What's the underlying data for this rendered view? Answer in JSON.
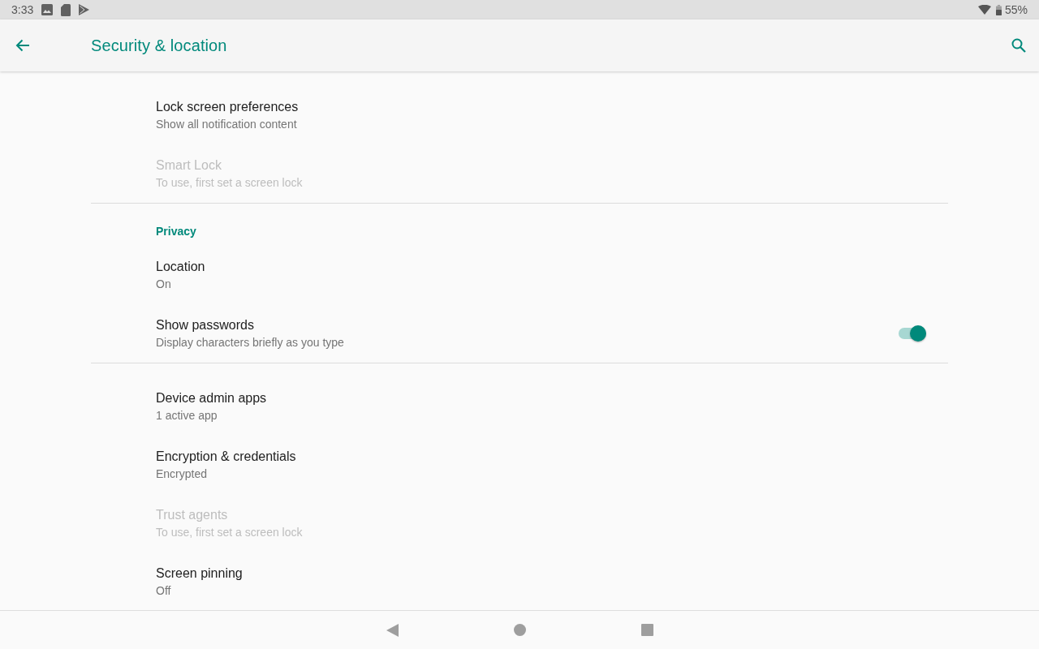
{
  "status_bar": {
    "time": "3:33",
    "battery": "55%"
  },
  "app_bar": {
    "title": "Security & location"
  },
  "sections": [
    {
      "items": [
        {
          "kind": "text",
          "title": "Lock screen preferences",
          "summary": "Show all notification content",
          "disabled": false
        },
        {
          "kind": "text",
          "title": "Smart Lock",
          "summary": "To use, first set a screen lock",
          "disabled": true
        }
      ]
    },
    {
      "header": "Privacy",
      "items": [
        {
          "kind": "text",
          "title": "Location",
          "summary": "On",
          "disabled": false
        },
        {
          "kind": "switch",
          "title": "Show passwords",
          "summary": "Display characters briefly as you type",
          "disabled": false,
          "on": true
        }
      ]
    },
    {
      "items": [
        {
          "kind": "text",
          "title": "Device admin apps",
          "summary": "1 active app",
          "disabled": false
        },
        {
          "kind": "text",
          "title": "Encryption & credentials",
          "summary": "Encrypted",
          "disabled": false
        },
        {
          "kind": "text",
          "title": "Trust agents",
          "summary": "To use, first set a screen lock",
          "disabled": true
        },
        {
          "kind": "text",
          "title": "Screen pinning",
          "summary": "Off",
          "disabled": false
        }
      ]
    }
  ]
}
